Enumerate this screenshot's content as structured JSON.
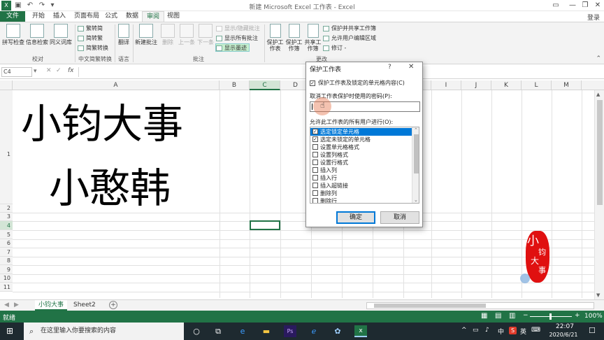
{
  "window": {
    "title": "新建 Microsoft Excel 工作表 - Excel",
    "signin_label": "登录"
  },
  "tabs": [
    "文件",
    "开始",
    "插入",
    "页面布局",
    "公式",
    "数据",
    "审阅",
    "视图"
  ],
  "active_tab": "审阅",
  "ribbon": {
    "proofing": {
      "label": "校对",
      "spelling": "拼写检查",
      "research": "信息检索",
      "thesaurus": "同义词库"
    },
    "chinese_conversion": {
      "label": "中文简繁转换",
      "to_trad": "繁转简",
      "to_simp": "简转繁",
      "convert": "简繁转换"
    },
    "language": {
      "label": "语言",
      "translate": "翻译"
    },
    "comments": {
      "label": "批注",
      "new": "新建批注",
      "delete": "删除",
      "prev": "上一条",
      "next": "下一条",
      "show_hide": "显示/隐藏批注",
      "show_all": "显示所有批注",
      "show_ink": "显示墨迹"
    },
    "changes": {
      "label": "更改",
      "protect_sheet": "保护工作表",
      "protect_workbook": "保护工作簿",
      "share_workbook": "共享工作簿",
      "protect_share": "保护并共享工作簿",
      "allow_edit": "允许用户编辑区域",
      "track": "修订 -"
    }
  },
  "formula_bar": {
    "namebox": "C4",
    "fx": "fx"
  },
  "columns": [
    "A",
    "B",
    "C",
    "D",
    "E",
    "F",
    "G",
    "H",
    "I",
    "J",
    "K",
    "L",
    "M"
  ],
  "rows": [
    "1",
    "2",
    "3",
    "4",
    "5",
    "6",
    "7",
    "8",
    "9",
    "10",
    "11"
  ],
  "cells": {
    "line1": "小钧大事",
    "line2": "小憨韩"
  },
  "sheets": [
    "小钧大事",
    "Sheet2"
  ],
  "status": {
    "ready": "就绪",
    "zoom": "100%"
  },
  "taskbar": {
    "search_placeholder": "在这里输入你要搜索的内容",
    "time": "22:07",
    "date": "2020/6/21",
    "ime": "中",
    "input_mode": "英"
  },
  "watermark": {
    "text1": "小",
    "text2": "钧",
    "text3": "大",
    "text4": "事"
  },
  "dialog": {
    "title": "保护工作表",
    "help": "?",
    "protect_check": "保护工作表及锁定的单元格内容(C)",
    "password_label": "取消工作表保护时使用的密码(P):",
    "password_value": "",
    "allow_label": "允许此工作表的所有用户进行(O):",
    "options": [
      {
        "label": "选定锁定单元格",
        "checked": true
      },
      {
        "label": "选定未锁定的单元格",
        "checked": true
      },
      {
        "label": "设置单元格格式",
        "checked": false
      },
      {
        "label": "设置列格式",
        "checked": false
      },
      {
        "label": "设置行格式",
        "checked": false
      },
      {
        "label": "插入列",
        "checked": false
      },
      {
        "label": "插入行",
        "checked": false
      },
      {
        "label": "插入超链接",
        "checked": false
      },
      {
        "label": "删除列",
        "checked": false
      },
      {
        "label": "删除行",
        "checked": false
      }
    ],
    "ok": "确定",
    "cancel": "取消"
  }
}
